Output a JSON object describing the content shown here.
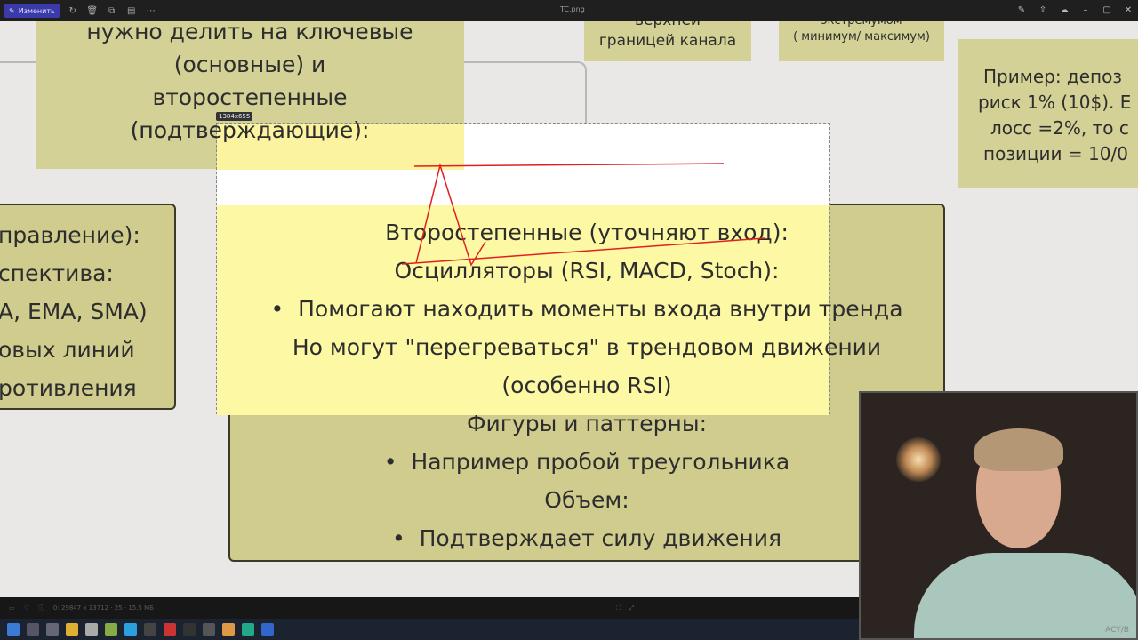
{
  "window": {
    "title": "TC.png",
    "edit_label": "Изменить",
    "selection_size": "1384x655"
  },
  "cards": {
    "top_left": {
      "lines": [
        "нужно делить на ключевые",
        "(основные) и",
        "второстепенные",
        "(подтверждающие):"
      ]
    },
    "top_mid": {
      "lines": [
        "верхней",
        "границей канала"
      ]
    },
    "top_right_small": {
      "lines": [
        "экстремумом",
        "( минимум/ максимум)"
      ]
    },
    "right": {
      "lines": [
        "Пример: депоз",
        "риск 1% (10$). Е",
        "лосс =2%, то с",
        "позиции = 10/0"
      ]
    },
    "left": {
      "lines": [
        "правление):",
        "спектива:",
        "A, EMA, SMA)",
        "овых линий",
        "ротивления"
      ]
    },
    "center": {
      "heading": "Второстепенные (уточняют вход):",
      "osc_heading": "Осцилляторы (RSI, MACD, Stoch):",
      "bullet1": "Помогают находить моменты входа внутри тренда",
      "note1": "Но могут \"перегреваться\" в трендовом движении",
      "note2": "(особенно RSI)",
      "fig_heading": "Фигуры и паттерны:",
      "bullet2": "Например пробой треугольника",
      "vol_heading": "Объем:",
      "bullet3": "Подтверждает силу движения"
    }
  },
  "statusbar": {
    "info": "0: 29847 x 13712 · 25 · 15.5 МБ"
  },
  "webcam": {
    "watermark": "ACY/B"
  },
  "colors": {
    "card": "#d3d196",
    "overlay_yellow": "#fdf8a3",
    "annotation_red": "#e02020"
  }
}
